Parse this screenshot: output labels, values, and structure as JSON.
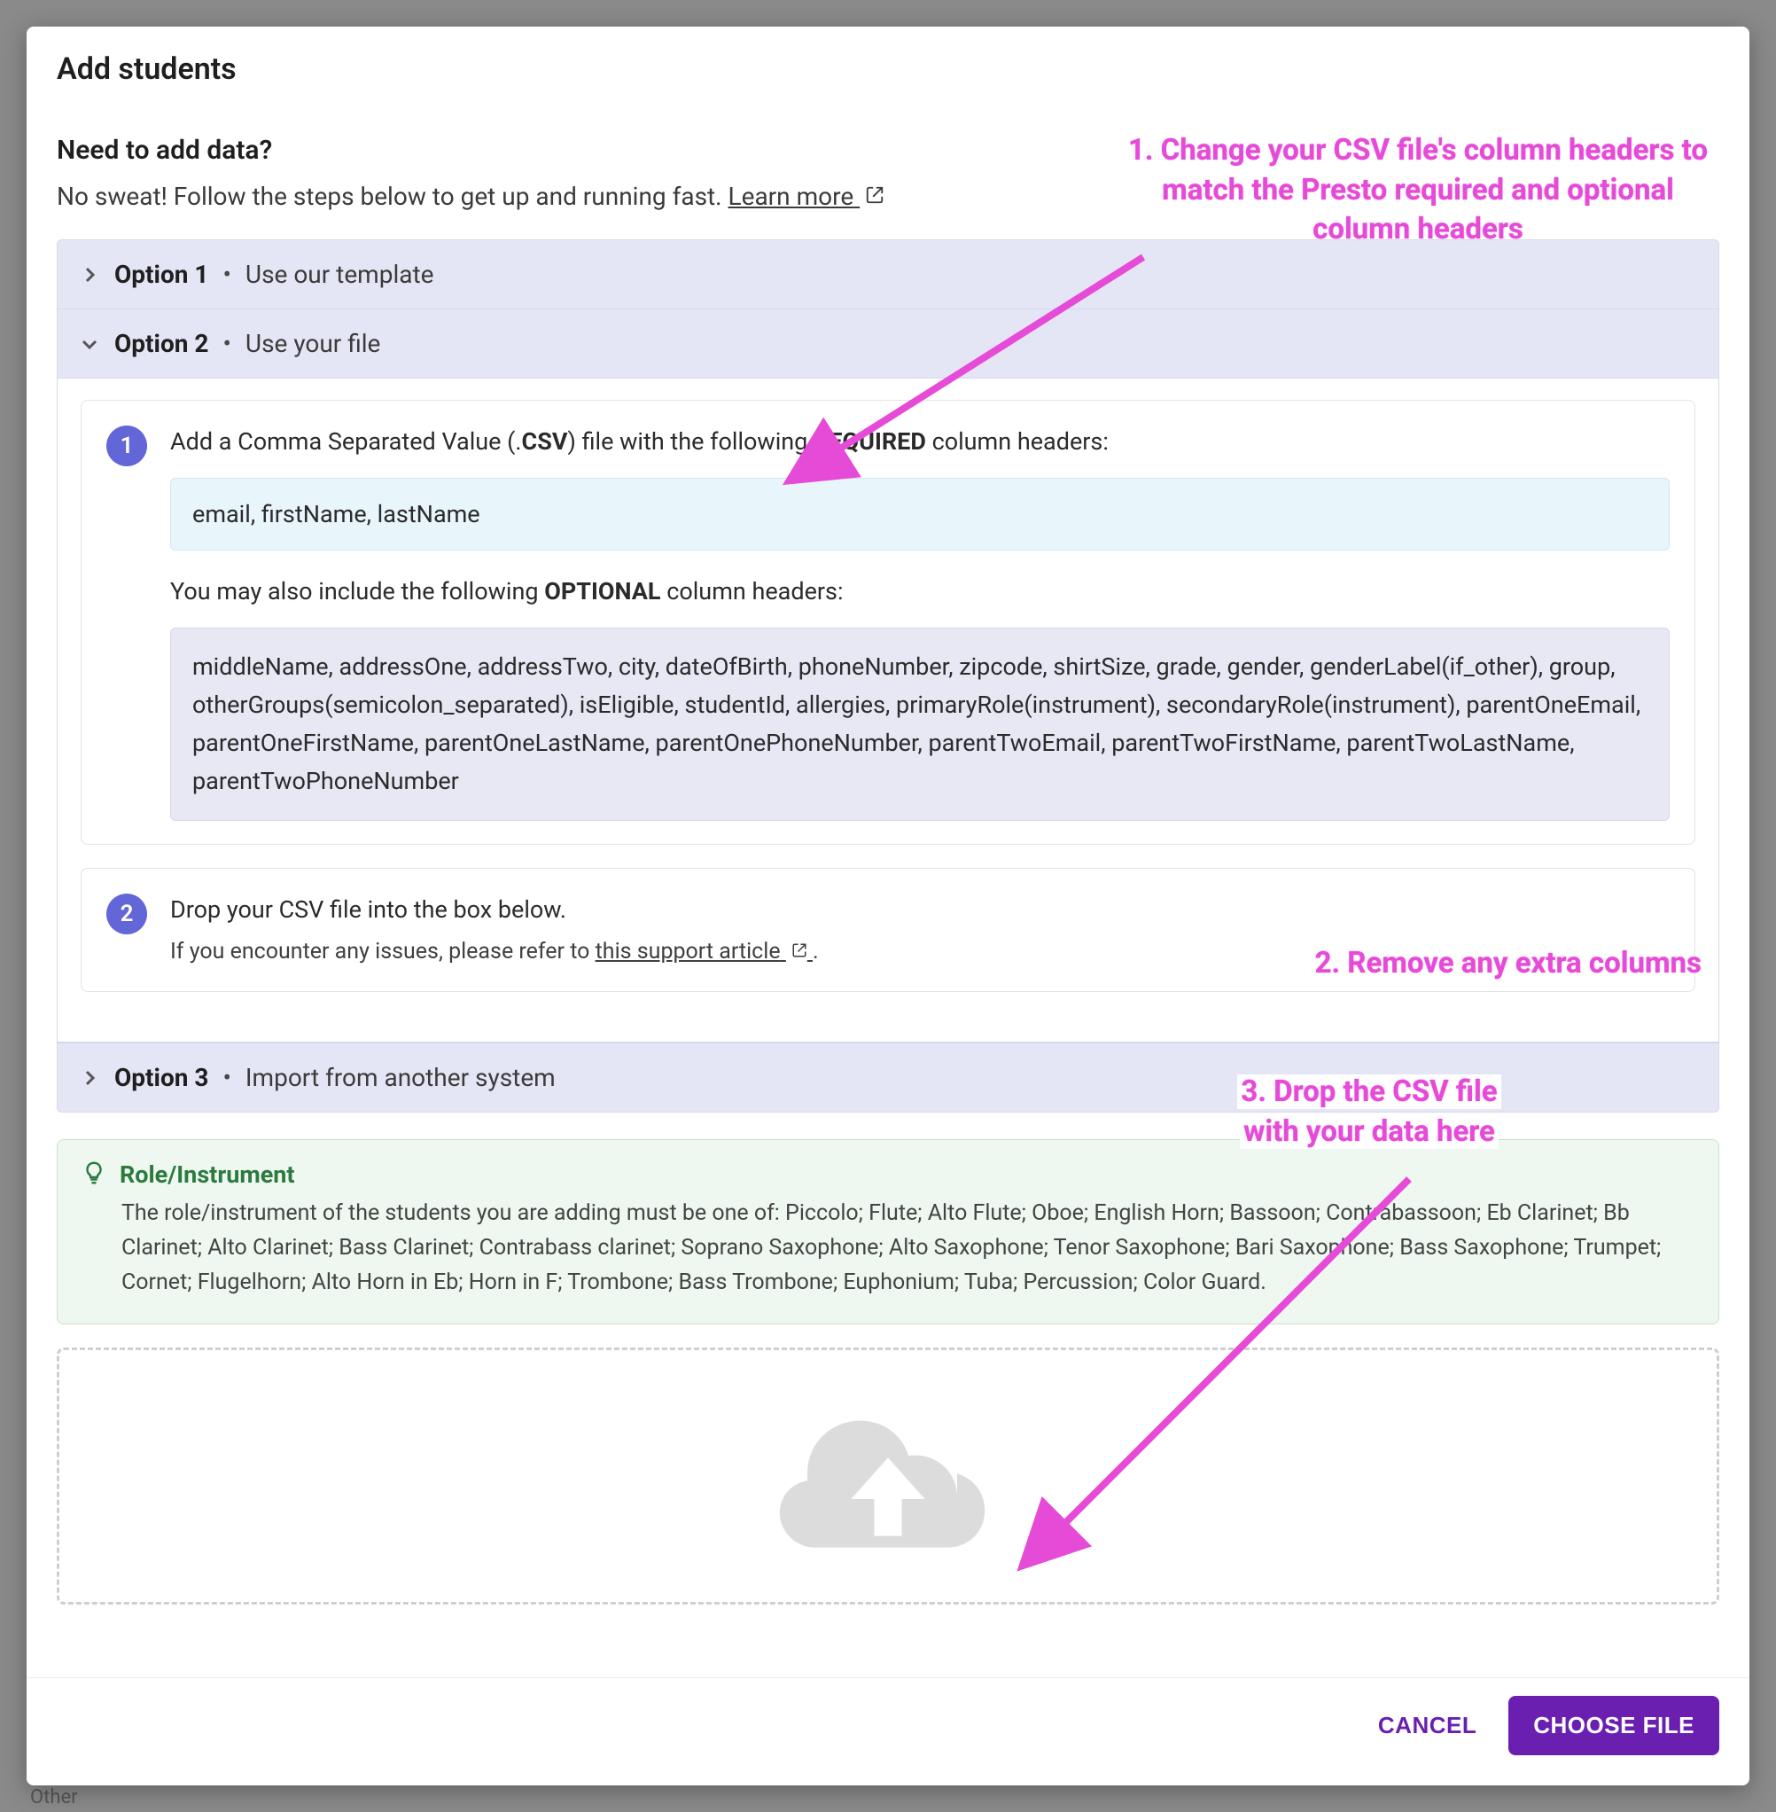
{
  "modal": {
    "title": "Add students",
    "need_heading": "Need to add data?",
    "need_sub_pre": "No sweat! Follow the steps below to get up and running fast. ",
    "learn_more": "Learn more"
  },
  "options": {
    "opt1_label": "Option 1",
    "opt1_desc": "Use our template",
    "opt2_label": "Option 2",
    "opt2_desc": "Use your file",
    "opt3_label": "Option 3",
    "opt3_desc": "Import from another system"
  },
  "step1": {
    "num": "1",
    "line_a": "Add a Comma Separated Value (.",
    "csv": "CSV",
    "line_b": ") file with the following ",
    "req": "REQUIRED",
    "line_c": " column headers:",
    "required_headers": "email, firstName, lastName",
    "may_a": "You may also include the following ",
    "opt": "OPTIONAL",
    "may_b": " column headers:",
    "optional_headers": "middleName, addressOne, addressTwo, city, dateOfBirth, phoneNumber, zipcode, shirtSize, grade, gender, genderLabel(if_other), group, otherGroups(semicolon_separated), isEligible, studentId, allergies, primaryRole(instrument), secondaryRole(instrument), parentOneEmail, parentOneFirstName, parentOneLastName, parentOnePhoneNumber, parentTwoEmail, parentTwoFirstName, parentTwoLastName, parentTwoPhoneNumber"
  },
  "step2": {
    "num": "2",
    "title": "Drop your CSV file into the box below.",
    "note_a": "If you encounter any issues, please refer to ",
    "note_link": "this support article",
    "note_b": "."
  },
  "instr": {
    "title": "Role/Instrument",
    "body": "The role/instrument of the students you are adding must be one of: Piccolo; Flute; Alto Flute; Oboe; English Horn; Bassoon; Contrabassoon; Eb Clarinet; Bb Clarinet; Alto Clarinet; Bass Clarinet; Contrabass clarinet; Soprano Saxophone; Alto Saxophone; Tenor Saxophone; Bari Saxophone; Bass Saxophone; Trumpet; Cornet; Flugelhorn; Alto Horn in Eb; Horn in F; Trombone; Bass Trombone; Euphonium; Tuba; Percussion; Color Guard."
  },
  "footer": {
    "cancel": "CANCEL",
    "choose": "CHOOSE FILE"
  },
  "callouts": {
    "c1": "1. Change your CSV file's column headers to match the Presto required and optional column headers",
    "c2": "2. Remove any extra columns",
    "c3a": "3. Drop the CSV file",
    "c3b": "with your data here"
  },
  "below": "Other"
}
